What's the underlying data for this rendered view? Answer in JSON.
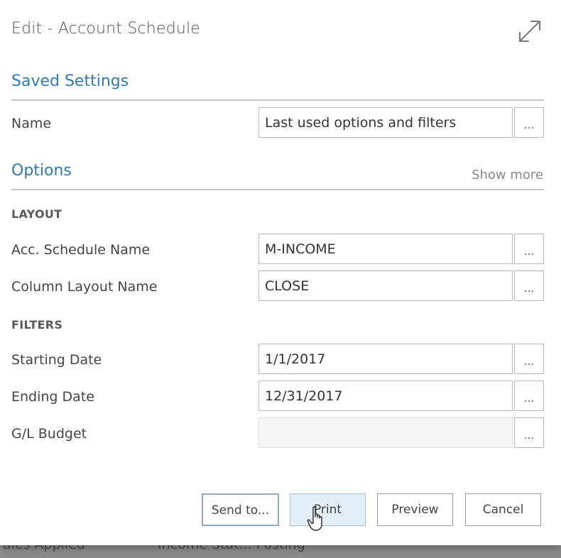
{
  "background": {
    "left_text": "ales Applied",
    "right_text": "Income Stat... Posting"
  },
  "dialog": {
    "title": "Edit - Account Schedule",
    "expand_icon": "expand-diagonal-arrows"
  },
  "saved_settings": {
    "heading": "Saved Settings",
    "name_label": "Name",
    "name_value": "Last used options and filters",
    "lookup_label": "..."
  },
  "options": {
    "heading": "Options",
    "show_more": "Show more",
    "layout": {
      "group_label": "LAYOUT",
      "acc_schedule_label": "Acc. Schedule Name",
      "acc_schedule_value": "M-INCOME",
      "column_layout_label": "Column Layout Name",
      "column_layout_value": "CLOSE"
    },
    "filters": {
      "group_label": "FILTERS",
      "starting_date_label": "Starting Date",
      "starting_date_value": "1/1/2017",
      "ending_date_label": "Ending Date",
      "ending_date_value": "12/31/2017",
      "gl_budget_label": "G/L Budget",
      "gl_budget_value": ""
    },
    "lookup_label": "..."
  },
  "buttons": {
    "send_to": "Send to...",
    "print": "Print",
    "preview": "Preview",
    "cancel": "Cancel"
  },
  "colors": {
    "section_heading": "#2f7ab8",
    "print_hover_bg": "#e4eef8"
  }
}
